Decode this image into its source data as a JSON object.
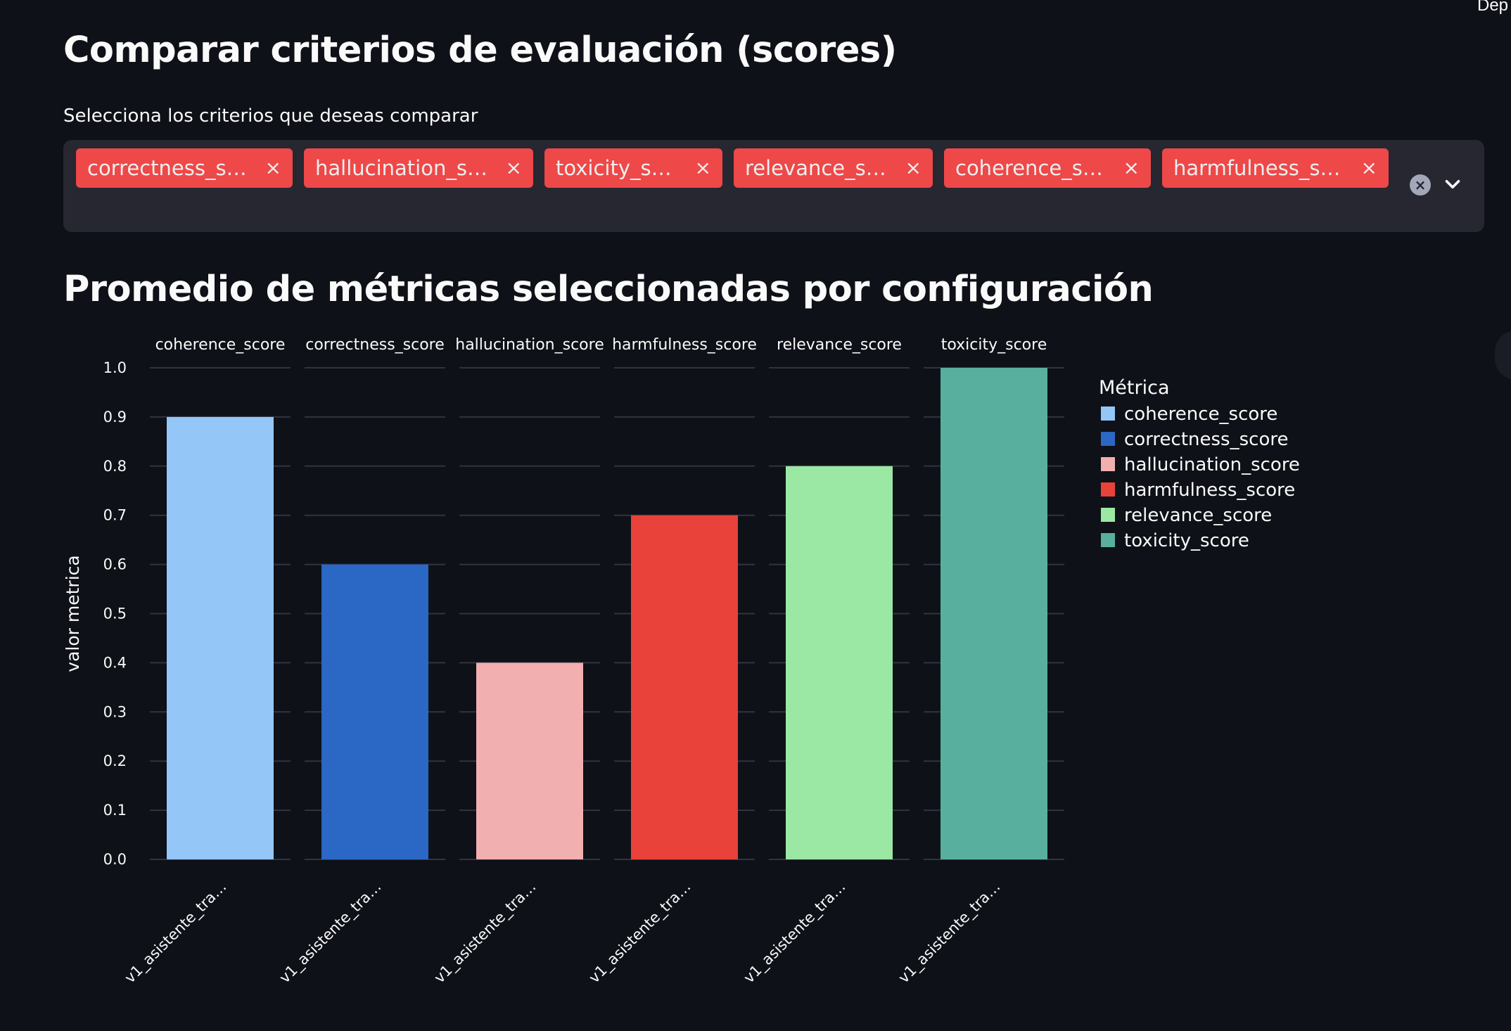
{
  "header": {
    "deploy_label": "Dep"
  },
  "page": {
    "title": "Comparar criterios de evaluación (scores)",
    "chart_heading": "Promedio de métricas seleccionadas por configuración"
  },
  "criteria_select": {
    "label": "Selecciona los criterios que deseas comparar",
    "selected": [
      "correctness_score",
      "hallucination_sc…",
      "toxicity_score",
      "relevance_score",
      "coherence_score",
      "harmfulness_score"
    ],
    "clear_icon": "clear-circle-icon",
    "open_icon": "chevron-down-icon",
    "tag_color": "#ff4b4b",
    "remove_glyph": "×"
  },
  "chart_data": {
    "type": "bar",
    "facets": [
      "coherence_score",
      "correctness_score",
      "hallucination_score",
      "harmfulness_score",
      "relevance_score",
      "toxicity_score"
    ],
    "categories": [
      "v1_asistente_tra…",
      "v1_asistente_tra…",
      "v1_asistente_tra…",
      "v1_asistente_tra…",
      "v1_asistente_tra…",
      "v1_asistente_tra…"
    ],
    "values": [
      0.9,
      0.6,
      0.4,
      0.7,
      0.8,
      1.0
    ],
    "colors": [
      "#94c6f7",
      "#2b67c4",
      "#f2afb0",
      "#e8423a",
      "#9ae8a4",
      "#58af9e"
    ],
    "ylabel": "valor metrica",
    "xlabel": "",
    "ylim": [
      0,
      1.0
    ],
    "yticks": [
      "0.0",
      "0.1",
      "0.2",
      "0.3",
      "0.4",
      "0.5",
      "0.6",
      "0.7",
      "0.8",
      "0.9",
      "1.0"
    ],
    "grid": true,
    "legend": {
      "title": "Métrica",
      "position": "right",
      "entries": [
        "coherence_score",
        "correctness_score",
        "hallucination_score",
        "harmfulness_score",
        "relevance_score",
        "toxicity_score"
      ]
    }
  }
}
